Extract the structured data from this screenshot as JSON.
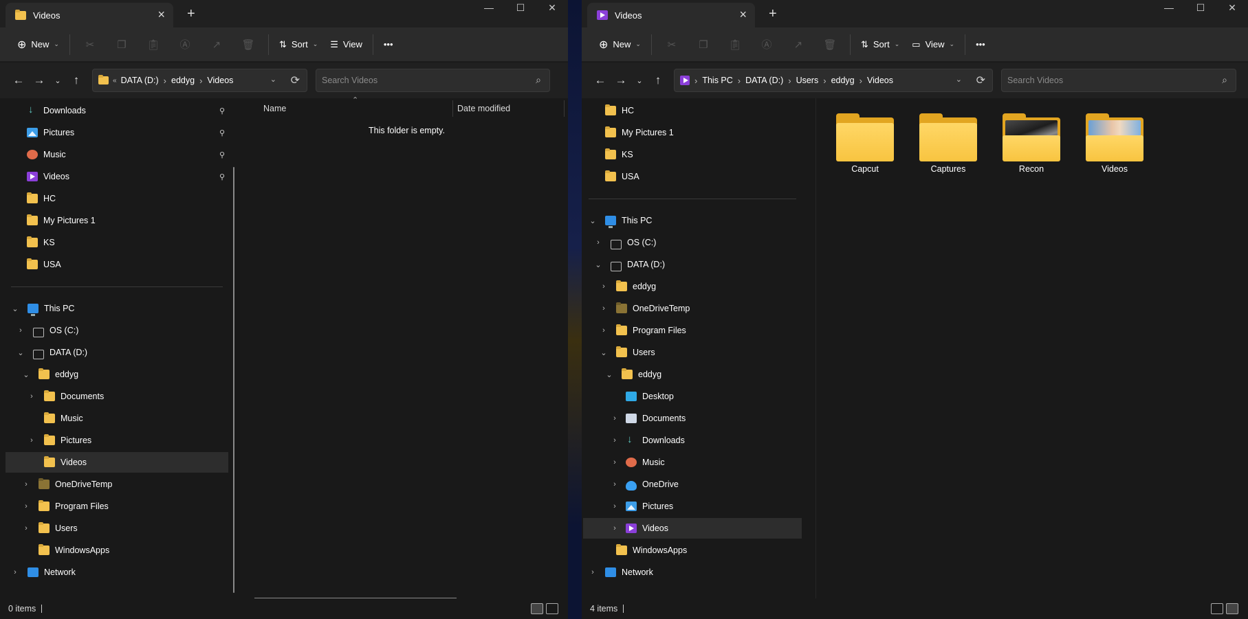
{
  "left": {
    "tab_title": "Videos",
    "toolbar": {
      "new": "New",
      "sort": "Sort",
      "view": "View"
    },
    "address": [
      "DATA (D:)",
      "eddyg",
      "Videos"
    ],
    "address_overflow": "«",
    "search_placeholder": "Search Videos",
    "nav": {
      "quick": [
        {
          "label": "Downloads"
        },
        {
          "label": "Pictures"
        },
        {
          "label": "Music"
        },
        {
          "label": "Videos"
        },
        {
          "label": "HC"
        },
        {
          "label": "My Pictures 1"
        },
        {
          "label": "KS"
        },
        {
          "label": "USA"
        }
      ],
      "tree": [
        {
          "label": "This PC"
        },
        {
          "label": "OS (C:)"
        },
        {
          "label": "DATA (D:)"
        },
        {
          "label": "eddyg"
        },
        {
          "label": "Documents"
        },
        {
          "label": "Music"
        },
        {
          "label": "Pictures"
        },
        {
          "label": "Videos"
        },
        {
          "label": "OneDriveTemp"
        },
        {
          "label": "Program Files"
        },
        {
          "label": "Users"
        },
        {
          "label": "WindowsApps"
        },
        {
          "label": "Network"
        }
      ]
    },
    "columns": {
      "name": "Name",
      "date": "Date modified"
    },
    "empty_text": "This folder is empty.",
    "status": "0 items"
  },
  "right": {
    "tab_title": "Videos",
    "toolbar": {
      "new": "New",
      "sort": "Sort",
      "view": "View"
    },
    "address": [
      "This PC",
      "DATA (D:)",
      "Users",
      "eddyg",
      "Videos"
    ],
    "search_placeholder": "Search Videos",
    "nav": {
      "quick": [
        {
          "label": "HC"
        },
        {
          "label": "My Pictures 1"
        },
        {
          "label": "KS"
        },
        {
          "label": "USA"
        }
      ],
      "tree": [
        {
          "label": "This PC"
        },
        {
          "label": "OS (C:)"
        },
        {
          "label": "DATA (D:)"
        },
        {
          "label": "eddyg"
        },
        {
          "label": "OneDriveTemp"
        },
        {
          "label": "Program Files"
        },
        {
          "label": "Users"
        },
        {
          "label": "eddyg"
        },
        {
          "label": "Desktop"
        },
        {
          "label": "Documents"
        },
        {
          "label": "Downloads"
        },
        {
          "label": "Music"
        },
        {
          "label": "OneDrive"
        },
        {
          "label": "Pictures"
        },
        {
          "label": "Videos"
        },
        {
          "label": "WindowsApps"
        },
        {
          "label": "Network"
        }
      ]
    },
    "items": [
      {
        "label": "Capcut"
      },
      {
        "label": "Captures"
      },
      {
        "label": "Recon"
      },
      {
        "label": "Videos"
      }
    ],
    "status": "4 items"
  },
  "icons": {
    "close": "✕",
    "minimize": "—",
    "maximize": "☐",
    "plus": "+",
    "more": "•••",
    "back": "←",
    "forward": "→",
    "up": "↑",
    "refresh": "⟳",
    "search": "⌕"
  },
  "colors": {
    "window_bg": "#191919",
    "toolbar_bg": "#2b2b2b",
    "selected_row": "#2d2d2d",
    "folder": "#f2c14e",
    "desktop_bg": "#0c1433"
  }
}
